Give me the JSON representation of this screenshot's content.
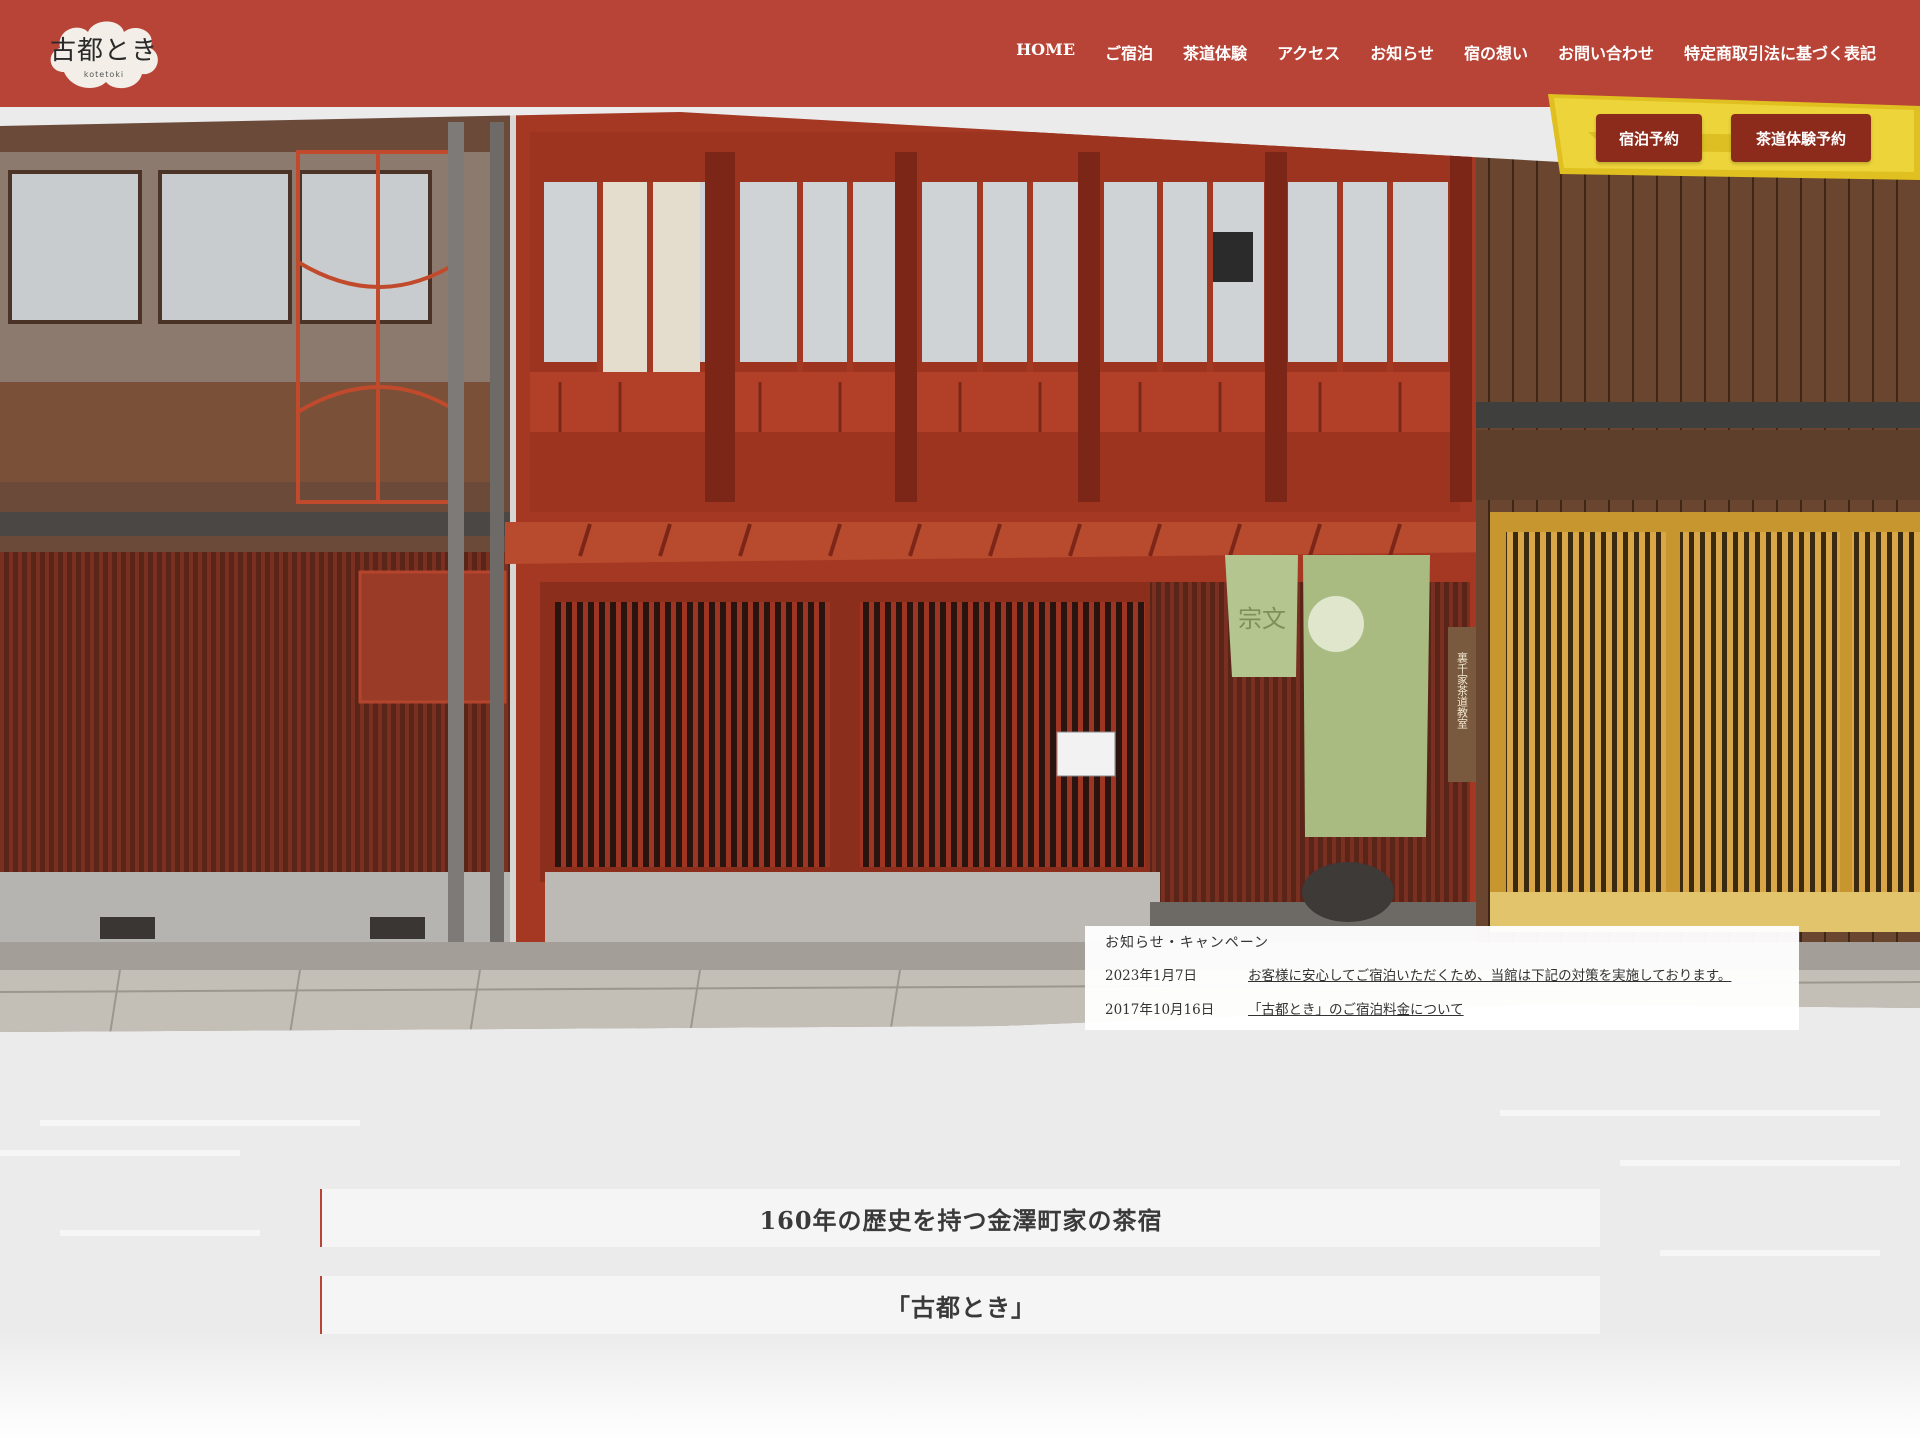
{
  "logo": {
    "text": "古都とき",
    "sub": "kotetoki"
  },
  "nav": [
    {
      "label": "HOME"
    },
    {
      "label": "ご宿泊"
    },
    {
      "label": "茶道体験"
    },
    {
      "label": "アクセス"
    },
    {
      "label": "お知らせ"
    },
    {
      "label": "宿の想い"
    },
    {
      "label": "お問い合わせ"
    },
    {
      "label": "特定商取引法に基づく表記"
    }
  ],
  "reserve": {
    "stay_label": "宿泊予約",
    "tea_label": "茶道体験予約"
  },
  "news": {
    "heading": "お知らせ・キャンペーン",
    "items": [
      {
        "date": "2023年1月7日",
        "title": "お客様に安心してご宿泊いただくため、当館は下記の対策を実施しております。"
      },
      {
        "date": "2017年10月16日",
        "title": "「古都とき」のご宿泊料金について"
      }
    ]
  },
  "intro": {
    "line1": "160年の歴史を持つ金澤町家の茶宿",
    "line2": "「古都とき」"
  },
  "hero": {
    "noren_text": "宗文",
    "signboard_text": "裏千家茶道教室"
  },
  "colors": {
    "header": "#b84437",
    "button": "#8c2a1c",
    "gold": "#e0c020",
    "wood_red": "#a53823"
  }
}
